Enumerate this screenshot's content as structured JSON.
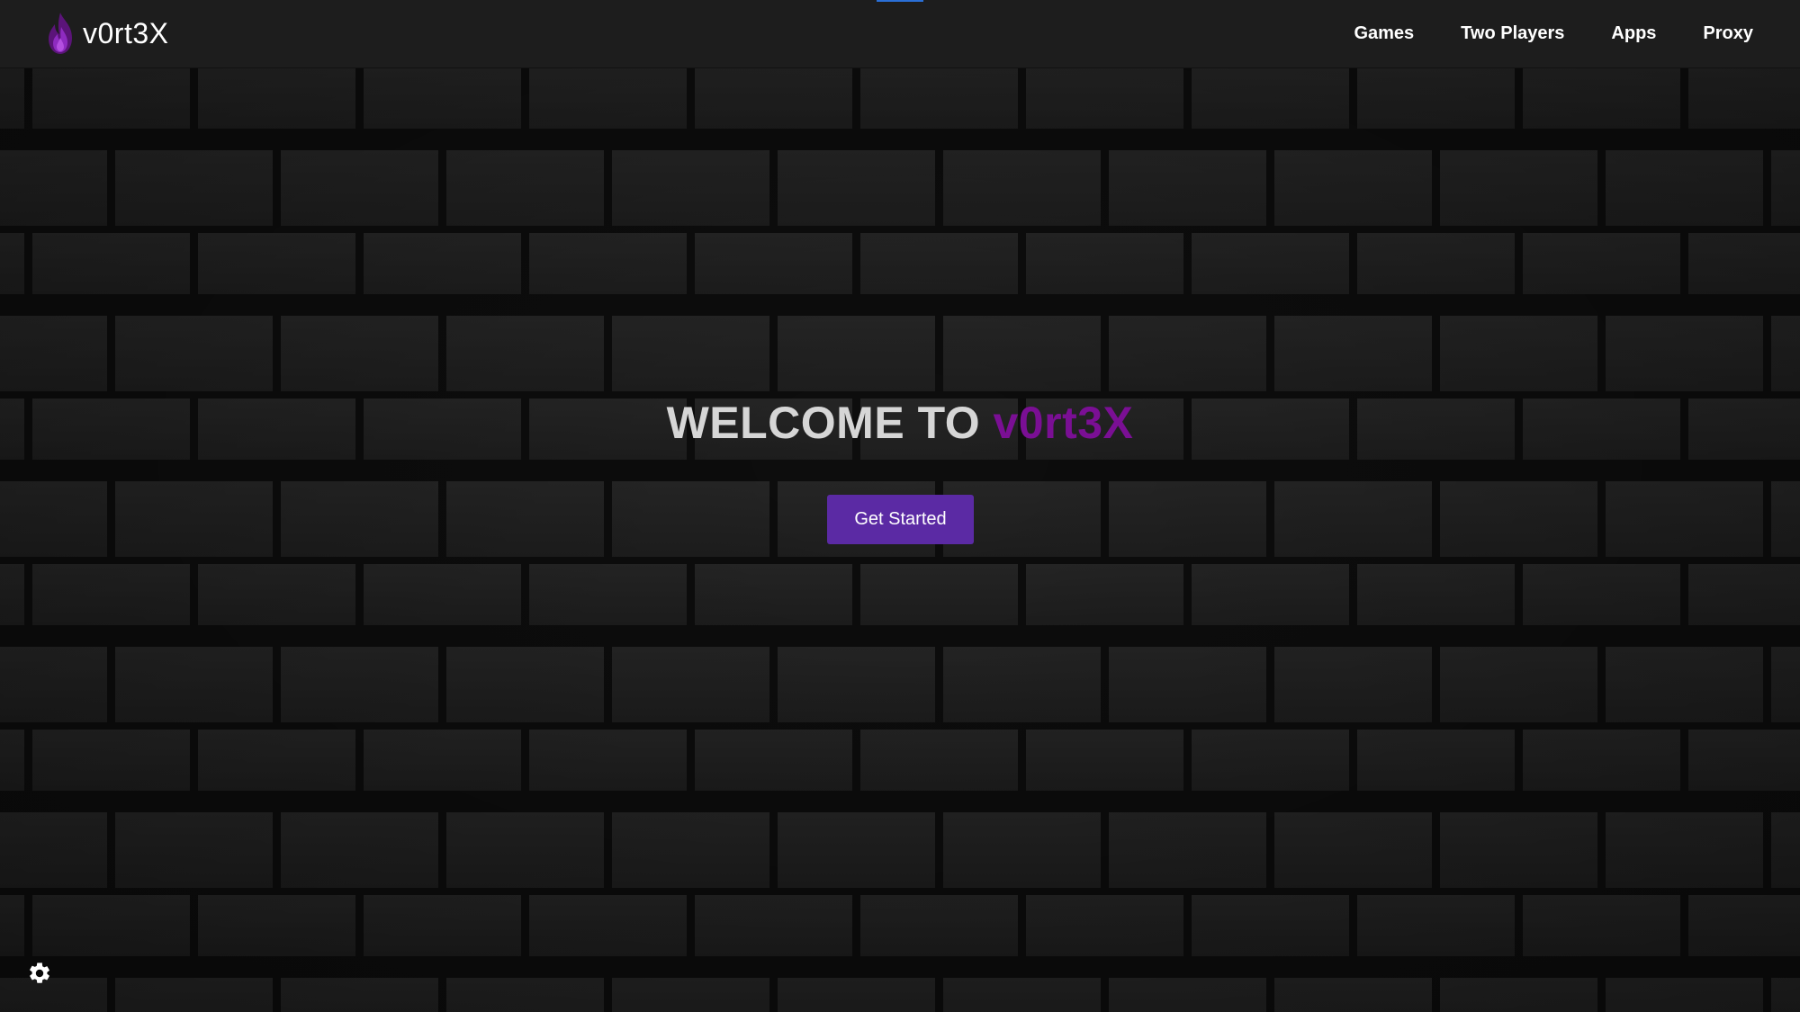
{
  "brand": {
    "name": "v0rt3X",
    "logo_icon": "flame-icon",
    "logo_color": "#7a1fa0"
  },
  "nav": {
    "items": [
      {
        "label": "Games"
      },
      {
        "label": "Two Players"
      },
      {
        "label": "Apps"
      },
      {
        "label": "Proxy"
      }
    ]
  },
  "hero": {
    "title_prefix": "WELCOME TO ",
    "title_brand": "v0rt3X",
    "cta_label": "Get Started"
  },
  "settings": {
    "icon": "gear-icon"
  },
  "colors": {
    "accent_purple": "#7a0f94",
    "button_purple": "#5b2aa4",
    "topbar": "#1d1d1d",
    "background": "#141414",
    "top_indicator": "#2a6fd6"
  }
}
